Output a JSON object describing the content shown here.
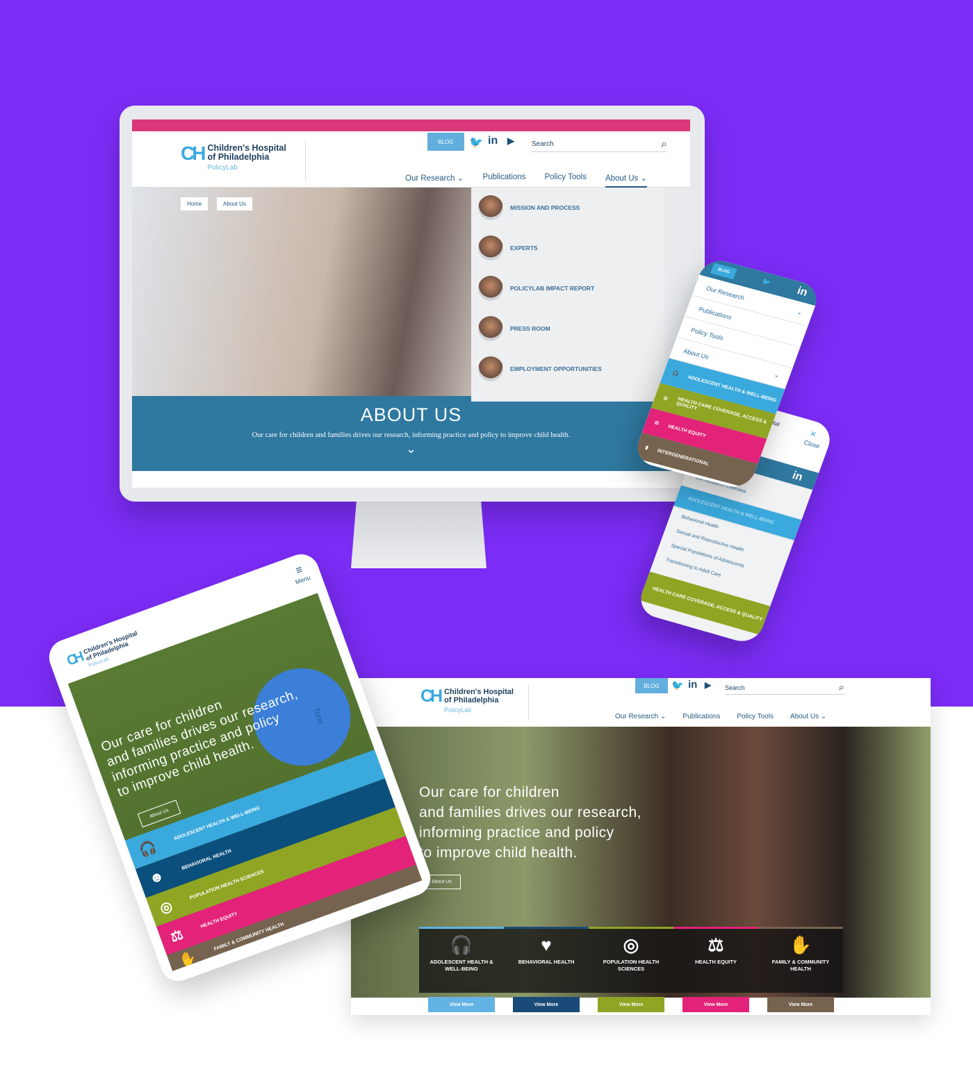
{
  "colors": {
    "background": "#7b2cf5",
    "blue": "#3aa9dd",
    "navy": "#0b4f7c",
    "green": "#8fa523",
    "pink": "#e3227a",
    "brown": "#76634f",
    "teal": "#2f78a0"
  },
  "brand": {
    "line1": "Children's Hospital",
    "line2": "of Philadelphia",
    "sub": "PolicyLab",
    "mark": "CH"
  },
  "topbar": {
    "blog": "BLOG",
    "social": [
      "twitter-icon",
      "linkedin-icon",
      "youtube-icon"
    ],
    "twitter": "🐦",
    "linkedin": "in",
    "youtube": "▶",
    "search_placeholder": "Search",
    "search_icon": "⌕"
  },
  "nav": {
    "items": [
      "Our Research",
      "Publications",
      "Policy Tools",
      "About Us"
    ],
    "chevron": "⌄"
  },
  "desktop": {
    "breadcrumb": [
      "Home",
      "About Us"
    ],
    "dropdown": [
      "MISSION AND PROCESS",
      "EXPERTS",
      "POLICYLAB IMPACT REPORT",
      "PRESS ROOM",
      "EMPLOYMENT OPPORTUNITIES"
    ],
    "about_title": "ABOUT US",
    "about_text": "Our care for children and families drives our research, informing practice and policy to improve child health.",
    "down": "⌄"
  },
  "home": {
    "hero_lines": [
      "Our care for children",
      "and families drives our research,",
      "informing practice and policy",
      "to improve child health."
    ],
    "button": "About Us",
    "cards": [
      {
        "label": "ADOLESCENT HEALTH & WELL-BEING",
        "icon": "headphones-brain-icon",
        "glyph": "🎧",
        "color": "#62b3e4",
        "button": "View More"
      },
      {
        "label": "BEHAVIORAL HEALTH",
        "icon": "head-heart-icon",
        "glyph": "♥",
        "color": "#1a4a78",
        "button": "View More"
      },
      {
        "label": "POPULATION HEALTH SCIENCES",
        "icon": "key-signal-icon",
        "glyph": "◎",
        "color": "#8fa523",
        "button": "View More"
      },
      {
        "label": "HEALTH EQUITY",
        "icon": "caduceus-scales-icon",
        "glyph": "⚖",
        "color": "#e3227a",
        "button": "View More"
      },
      {
        "label": "FAMILY & COMMUNITY HEALTH",
        "icon": "hand-icon",
        "glyph": "✋",
        "color": "#76634f",
        "button": "View More"
      }
    ]
  },
  "tablet": {
    "menu": "Menu",
    "menu_icon": "≡",
    "hero_lines": [
      "Our care for children",
      "and families drives our research,",
      "informing practice and policy",
      "to improve child health."
    ],
    "ball_text": "Tone",
    "button": "About Us",
    "bands": [
      "ADOLESCENT HEALTH & WELL-BEING",
      "BEHAVIORAL HEALTH",
      "POPULATION HEALTH SCIENCES",
      "HEALTH EQUITY",
      "FAMILY & COMMUNITY HEALTH"
    ]
  },
  "phone1": {
    "menu": [
      "Our Research",
      "Publications",
      "Policy Tools",
      "About Us"
    ],
    "bands": [
      "ADOLESCENT HEALTH & WELL-BEING",
      "HEALTH CARE COVERAGE, ACCESS & QUALITY",
      "HEALTH EQUITY",
      "INTERGENERATIONAL"
    ]
  },
  "phone2": {
    "brand_fragment": "ospital\nhia",
    "close": "Close",
    "close_icon": "✕",
    "items": [
      "Our Research Overview",
      "ADOLESCENT HEALTH & WELL-BEING",
      "Behavioral Health",
      "Sexual and Reproductive Health",
      "Special Populations of Adolescents",
      "Transitioning to Adult Care"
    ],
    "footer_band": "HEALTH CARE COVERAGE, ACCESS & QUALITY"
  }
}
